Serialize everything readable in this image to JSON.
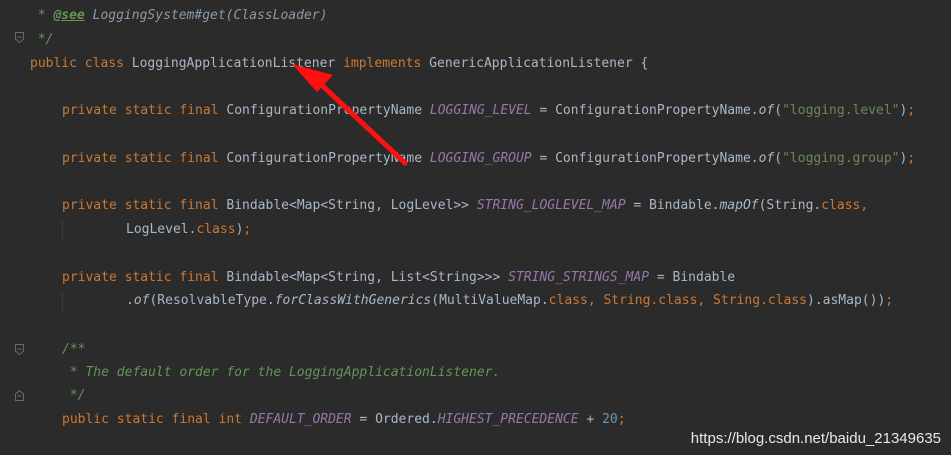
{
  "code": {
    "l1": {
      "p1": " * ",
      "tag": "@see",
      "p2": " ",
      "ref": "LoggingSystem#get(ClassLoader)"
    },
    "l2": " */",
    "l3": {
      "kw1": "public class ",
      "name": "LoggingApplicationListener ",
      "kw2": "implements ",
      "iface": "GenericApplicationListener {"
    },
    "l4": {
      "kw": "private static final ",
      "type": "ConfigurationPropertyName ",
      "field": "LOGGING_LEVEL",
      "mid": " = ConfigurationPropertyName.",
      "m": "of",
      "op": "(",
      "str": "\"logging.level\"",
      "end": ")",
      "semi": ";"
    },
    "l5": {
      "kw": "private static final ",
      "type": "ConfigurationPropertyName ",
      "field": "LOGGING_GROUP",
      "mid": " = ConfigurationPropertyName.",
      "m": "of",
      "op": "(",
      "str": "\"logging.group\"",
      "end": ")",
      "semi": ";"
    },
    "l6": {
      "kw": "private static final ",
      "type": "Bindable<Map<String, LogLevel>> ",
      "field": "STRING_LOGLEVEL_MAP",
      "mid": " = Bindable.",
      "m": "mapOf",
      "args": "(String.",
      "cls": "class",
      "comma": ","
    },
    "l7": {
      "txt": "LogLevel.",
      "cls": "class",
      "end": ")",
      "semi": ";"
    },
    "l8": {
      "kw": "private static final ",
      "type": "Bindable<Map<String, List<String>>> ",
      "field": "STRING_STRINGS_MAP",
      "mid": " = Bindable"
    },
    "l9": {
      "p1": ".",
      "m1": "of",
      "p2": "(ResolvableType.",
      "m2": "forClassWithGenerics",
      "p3": "(MultiValueMap.",
      "c1": "class",
      "p4": ", String.",
      "c2": "class",
      "p5": ", String.",
      "c3": "class",
      "p6": ").asMap())",
      "semi": ";"
    },
    "l10": "/**",
    "l11": " * The default order for the LoggingApplicationListener.",
    "l12": " */",
    "l13": {
      "kw": "public static final int ",
      "field": "DEFAULT_ORDER",
      "mid": " = Ordered.",
      "field2": "HIGHEST_PRECEDENCE",
      "op": " + ",
      "num": "20",
      "semi": ";"
    }
  },
  "watermark": "https://blog.csdn.net/baidu_21349635",
  "colors": {
    "background": "#2b2b2b",
    "keyword": "#cc7832",
    "field": "#9876aa",
    "string": "#6a8759",
    "number": "#6897bb",
    "doc_comment": "#629755",
    "arrow": "#ff0000"
  }
}
